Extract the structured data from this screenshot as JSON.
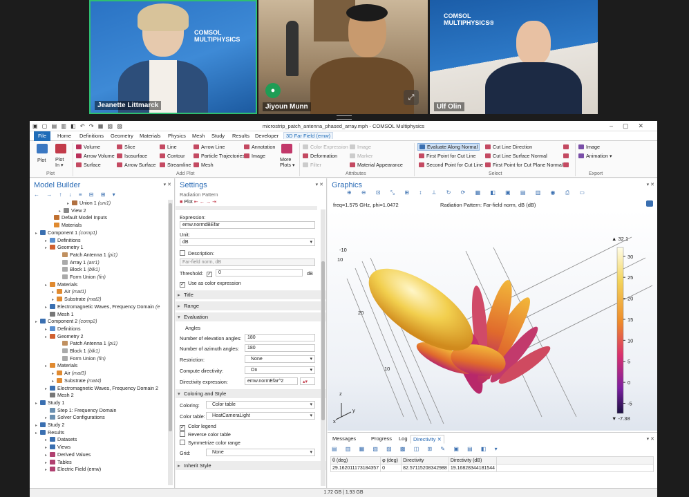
{
  "participants": [
    {
      "name": "Jeanette Littmarck",
      "logo": "COMSOL MULTIPHYSICS"
    },
    {
      "name": "Jiyoun Munn"
    },
    {
      "name": "Ulf Olin",
      "logo": "COMSOL MULTIPHYSICS®"
    }
  ],
  "window": {
    "title": "microstrip_patch_antenna_phased_array.mph - COMSOL Multiphysics"
  },
  "menu": [
    "File",
    "Home",
    "Definitions",
    "Geometry",
    "Materials",
    "Physics",
    "Mesh",
    "Study",
    "Results",
    "Developer",
    "3D Far Field (emw)"
  ],
  "ribbon": {
    "plot": "Plot",
    "plot_in": "Plot In",
    "add_plot": [
      "Volume",
      "Arrow Volume",
      "Surface",
      "Slice",
      "Isosurface",
      "Arrow Surface",
      "Line",
      "Contour",
      "Streamline",
      "Arrow Line",
      "Particle Trajectories",
      "Mesh",
      "Annotation",
      "Image"
    ],
    "more_plots": "More Plots",
    "attributes": [
      "Color Expression",
      "Deformation",
      "Filter",
      "Image",
      "Marker",
      "Material Appearance"
    ],
    "select": [
      "Evaluate Along Normal",
      "First Point for Cut Line",
      "Second Point for Cut Line",
      "Cut Line Direction",
      "Cut Line Surface Normal",
      "First Point for Cut Plane Normal"
    ],
    "export": [
      "Image",
      "Animation"
    ],
    "groups": {
      "plot": "Plot",
      "add_plot": "Add Plot",
      "attributes": "Attributes",
      "select": "Select",
      "export": "Export"
    }
  },
  "model_builder": {
    "title": "Model Builder",
    "items": [
      {
        "t": "Union 1 ",
        "i": "(uni1)"
      },
      {
        "t": "View 2"
      },
      {
        "t": "Default Model Inputs"
      },
      {
        "t": "Materials"
      },
      {
        "t": "Component 1 ",
        "i": "(comp1)"
      },
      {
        "t": "Definitions"
      },
      {
        "t": "Geometry 1"
      },
      {
        "t": "Patch Antenna 1 ",
        "i": "(pi1)"
      },
      {
        "t": "Array 1 ",
        "i": "(arr1)"
      },
      {
        "t": "Block 1 ",
        "i": "(blk1)"
      },
      {
        "t": "Form Union ",
        "i": "(fin)"
      },
      {
        "t": "Materials"
      },
      {
        "t": "Air ",
        "i": "(mat1)"
      },
      {
        "t": "Substrate ",
        "i": "(mat2)"
      },
      {
        "t": "Electromagnetic Waves, Frequency Domain ",
        "i": "(e"
      },
      {
        "t": "Mesh 1"
      },
      {
        "t": "Component 2 ",
        "i": "(comp2)"
      },
      {
        "t": "Definitions"
      },
      {
        "t": "Geometry 2"
      },
      {
        "t": "Patch Antenna 1 ",
        "i": "(pi1)"
      },
      {
        "t": "Block 1 ",
        "i": "(blk1)"
      },
      {
        "t": "Form Union ",
        "i": "(fin)"
      },
      {
        "t": "Materials"
      },
      {
        "t": "Air ",
        "i": "(mat3)"
      },
      {
        "t": "Substrate ",
        "i": "(mat4)"
      },
      {
        "t": "Electromagnetic Waves, Frequency Domain 2"
      },
      {
        "t": "Mesh 2"
      },
      {
        "t": "Study 1"
      },
      {
        "t": "Step 1: Frequency Domain"
      },
      {
        "t": "Solver Configurations"
      },
      {
        "t": "Study 2"
      },
      {
        "t": "Results"
      },
      {
        "t": "Datasets"
      },
      {
        "t": "Views"
      },
      {
        "t": "Derived Values"
      },
      {
        "t": "Tables"
      },
      {
        "t": "Electric Field (emw)"
      }
    ]
  },
  "settings": {
    "title": "Settings",
    "subtitle": "Radiation Pattern",
    "plot_btn": "Plot",
    "expression_label": "Expression:",
    "expression": "emw.normdBEfar",
    "unit_label": "Unit:",
    "unit": "dB",
    "description_label": "Description:",
    "description": "Far-field norm, dB",
    "threshold_label": "Threshold:",
    "threshold": "0",
    "threshold_unit": "dB",
    "use_color": "Use as color expression",
    "sections": {
      "title": "Title",
      "range": "Range",
      "evaluation": "Evaluation",
      "coloring": "Coloring and Style",
      "inherit": "Inherit Style"
    },
    "angles": "Angles",
    "elev_label": "Number of elevation angles:",
    "elev": "180",
    "azim_label": "Number of azimuth angles:",
    "azim": "180",
    "restriction_label": "Restriction:",
    "restriction": "None",
    "directivity_label": "Compute directivity:",
    "directivity": "On",
    "dir_expr_label": "Directivity expression:",
    "dir_expr": "emw.normEfar^2",
    "coloring_label": "Coloring:",
    "coloring": "Color table",
    "color_table_label": "Color table:",
    "color_table": "HeatCameraLight",
    "color_legend": "Color legend",
    "reverse": "Reverse color table",
    "symmetrize": "Symmetrize color range",
    "grid_label": "Grid:",
    "grid": "None"
  },
  "graphics": {
    "title": "Graphics",
    "freq": "freq=1.575 GHz, phi=1.0472",
    "pattern_title": "Radiation Pattern: Far-field norm, dB (dB)",
    "max": "32.1",
    "min": "-7.38",
    "ticks": [
      "30",
      "25",
      "20",
      "15",
      "10",
      "5",
      "0",
      "-5"
    ],
    "grid_labels": [
      "-10",
      "10",
      "20",
      "10"
    ],
    "axes": {
      "z": "z",
      "y": "y",
      "x": "x"
    }
  },
  "bottom": {
    "tabs": [
      "Messages",
      "Progress",
      "Log",
      "Directivity"
    ],
    "headers": [
      "θ (deg)",
      "φ (deg)",
      "Directivity",
      "Directivity (dB)"
    ],
    "row": [
      "29.162011173184357",
      "0",
      "82.57115208342988",
      "19.16828344181544"
    ]
  },
  "status": "1.72 GB | 1.93 GB",
  "colors": {
    "accent": "#2a6bb5",
    "file": "#1f6cb8",
    "green": "#1f9d55"
  }
}
